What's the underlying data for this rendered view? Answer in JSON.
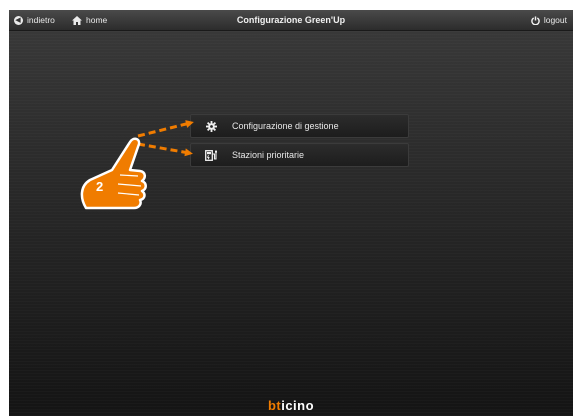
{
  "header": {
    "back_label": "indietro",
    "home_label": "home",
    "title": "Configurazione Green'Up",
    "logout_label": "logout"
  },
  "menu": {
    "items": [
      {
        "label": "Configurazione di gestione",
        "icon": "gear-icon"
      },
      {
        "label": "Stazioni prioritarie",
        "icon": "charging-station-icon"
      }
    ]
  },
  "annotation": {
    "step_number": "2",
    "color": "#f07c00"
  },
  "brand": {
    "logo_prefix": "bt",
    "logo_suffix": "icino",
    "accent": "#f07c00"
  }
}
